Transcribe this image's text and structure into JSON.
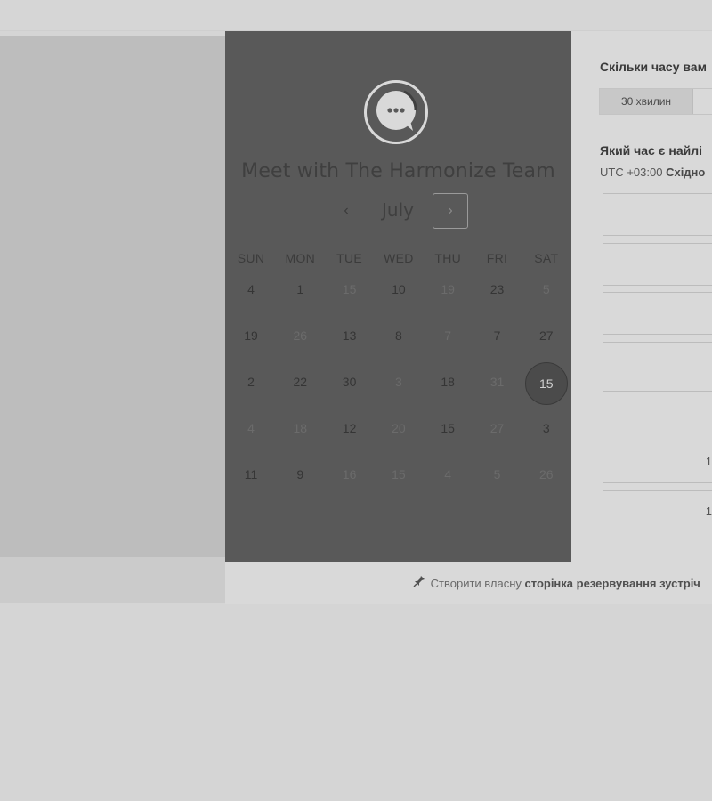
{
  "calendar": {
    "title": "Meet with The Harmonize Team",
    "month": "July",
    "prev_icon": "‹",
    "next_icon": "›",
    "logo_icon": "chat-bubble-icon",
    "weekdays": [
      "SUN",
      "MON",
      "TUE",
      "WED",
      "THU",
      "FRI",
      "SAT"
    ],
    "weeks": [
      [
        {
          "d": "4",
          "on": true
        },
        {
          "d": "1",
          "on": true
        },
        {
          "d": "15",
          "on": false
        },
        {
          "d": "10",
          "on": true
        },
        {
          "d": "19",
          "on": false
        },
        {
          "d": "23",
          "on": true
        },
        {
          "d": "5",
          "on": false
        }
      ],
      [
        {
          "d": "19",
          "on": true
        },
        {
          "d": "26",
          "on": false
        },
        {
          "d": "13",
          "on": true
        },
        {
          "d": "8",
          "on": true
        },
        {
          "d": "7",
          "on": false
        },
        {
          "d": "7",
          "on": true
        },
        {
          "d": "27",
          "on": true
        }
      ],
      [
        {
          "d": "2",
          "on": true
        },
        {
          "d": "22",
          "on": true
        },
        {
          "d": "30",
          "on": true
        },
        {
          "d": "3",
          "on": false
        },
        {
          "d": "18",
          "on": true
        },
        {
          "d": "31",
          "on": false
        },
        {
          "d": "15",
          "on": true,
          "selected": true
        }
      ],
      [
        {
          "d": "4",
          "on": false
        },
        {
          "d": "18",
          "on": false
        },
        {
          "d": "12",
          "on": true
        },
        {
          "d": "20",
          "on": false
        },
        {
          "d": "15",
          "on": true
        },
        {
          "d": "27",
          "on": false
        },
        {
          "d": "3",
          "on": true
        }
      ],
      [
        {
          "d": "11",
          "on": true
        },
        {
          "d": "9",
          "on": true
        },
        {
          "d": "16",
          "on": false
        },
        {
          "d": "15",
          "on": false
        },
        {
          "d": "4",
          "on": false
        },
        {
          "d": "5",
          "on": false
        },
        {
          "d": "26",
          "on": false
        }
      ]
    ]
  },
  "booking": {
    "duration_question": "Скільки часу вам",
    "duration_selected": "30 хвилин",
    "time_question": "Який час є найлі",
    "timezone_prefix": "UTC +03:00",
    "timezone_name": "Східно",
    "slots": [
      "",
      "",
      "",
      "",
      "",
      "1",
      "1"
    ]
  },
  "footer": {
    "icon": "pin-icon",
    "prefix": "Створити власну",
    "link": "сторінка резервування зустріч"
  }
}
